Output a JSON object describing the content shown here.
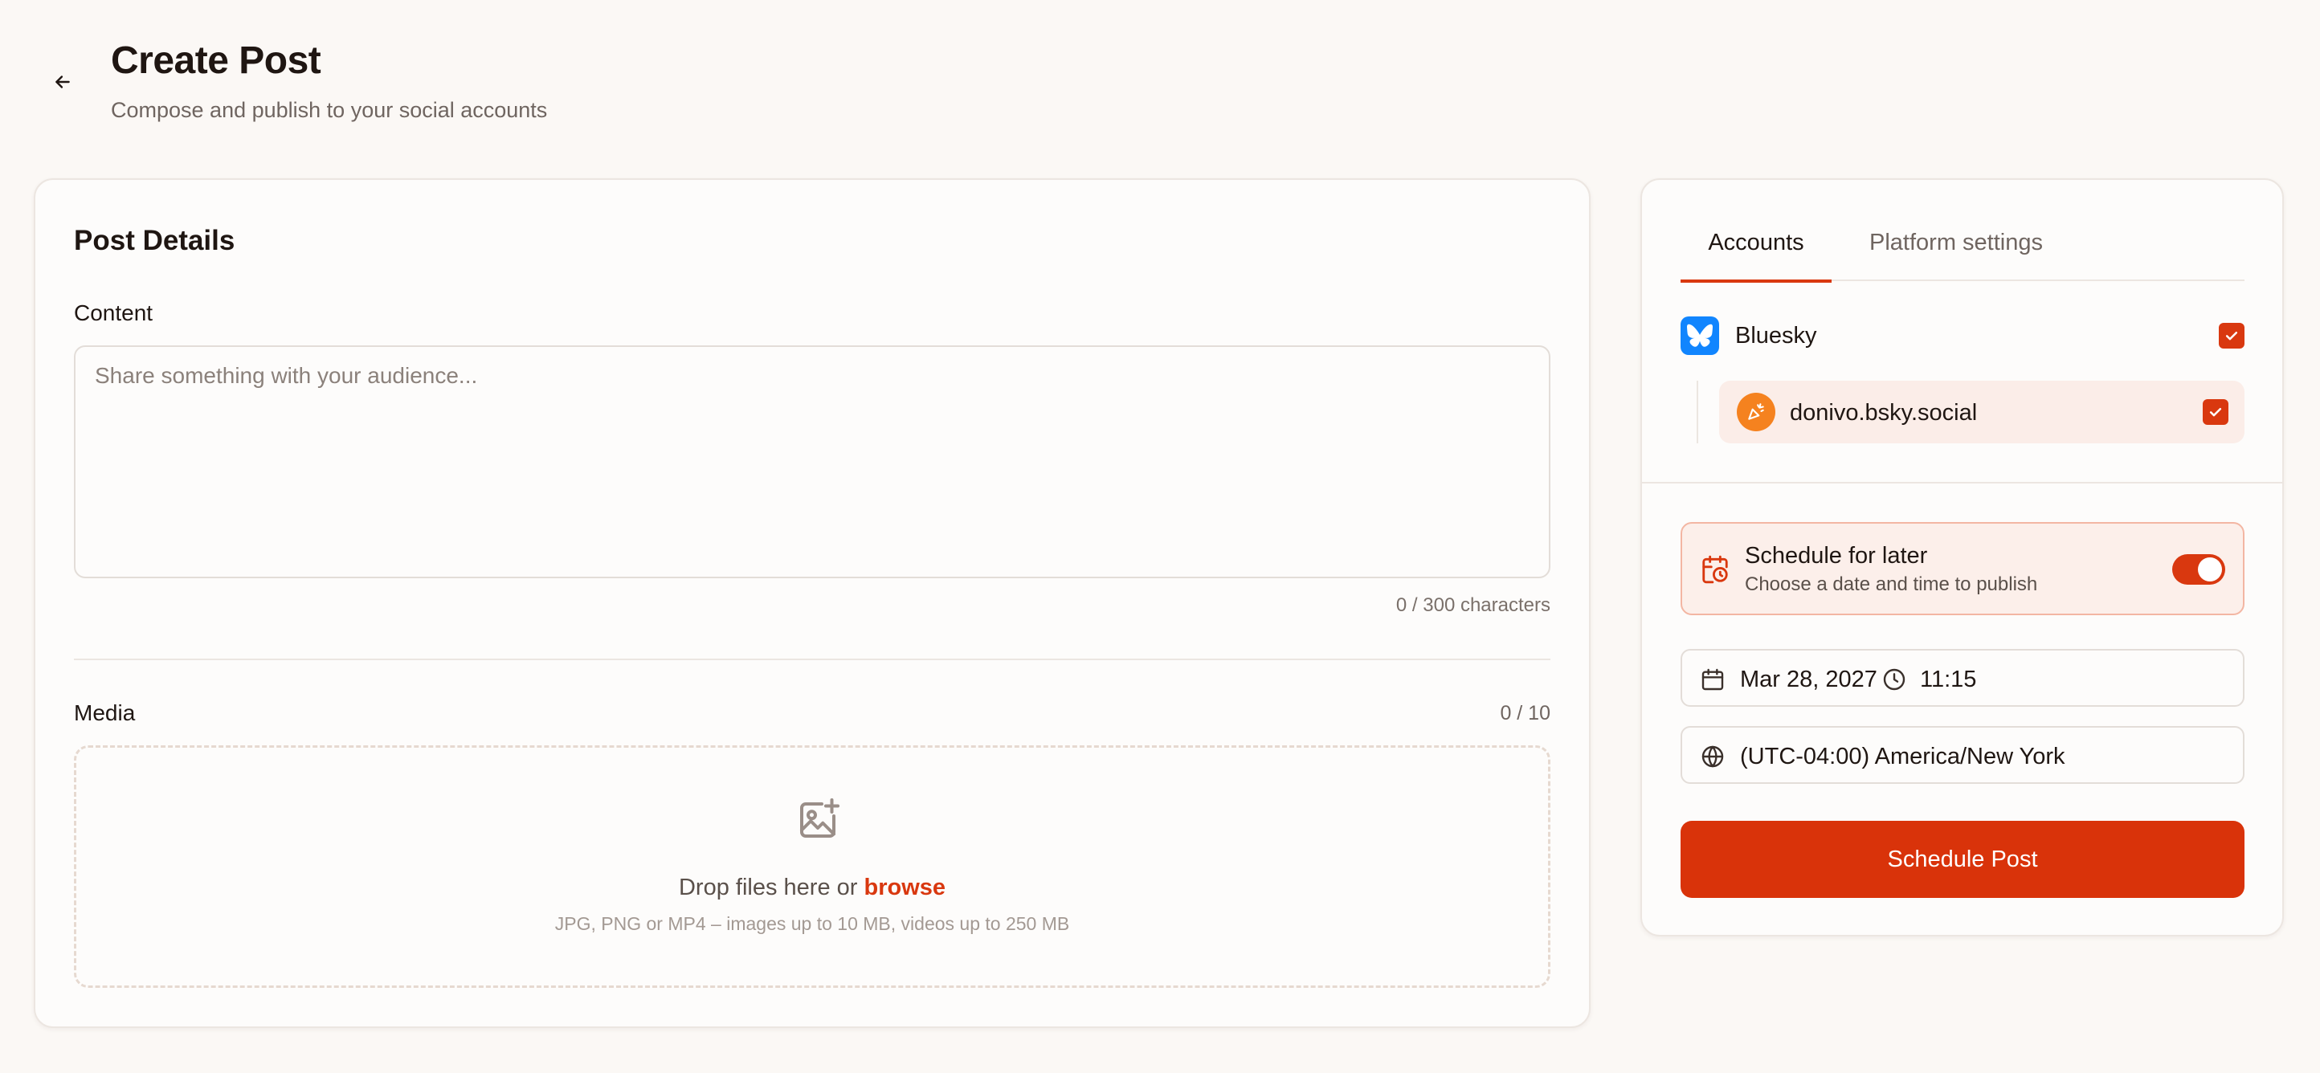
{
  "header": {
    "title": "Create Post",
    "subtitle": "Compose and publish to your social accounts"
  },
  "post_details": {
    "title": "Post Details",
    "content_label": "Content",
    "content_value": "",
    "content_placeholder": "Share something with your audience...",
    "char_count": "0 / 300 characters",
    "media_label": "Media",
    "media_count": "0 / 10",
    "drop_text": "Drop files here or",
    "browse_label": "browse",
    "drop_hint": "JPG, PNG or MP4 – images up to 10 MB, videos up to 250 MB"
  },
  "tabs": [
    {
      "label": "Accounts",
      "active": true
    },
    {
      "label": "Platform settings",
      "active": false
    }
  ],
  "platforms": [
    {
      "name": "Bluesky",
      "icon": "bluesky-butterfly-icon",
      "checked": true,
      "accounts": [
        {
          "handle": "donivo.bsky.social",
          "checked": true
        }
      ]
    }
  ],
  "schedule": {
    "title": "Schedule for later",
    "subtitle": "Choose a date and time to publish",
    "enabled": true,
    "date": "Mar 28, 2027",
    "time": "11:15",
    "timezone": "(UTC-04:00) America/New York"
  },
  "actions": {
    "schedule_label": "Schedule Post"
  },
  "colors": {
    "accent": "#d9380f",
    "bluesky": "#1185fe",
    "avatar": "#f5821f",
    "background": "#fbf8f5"
  }
}
